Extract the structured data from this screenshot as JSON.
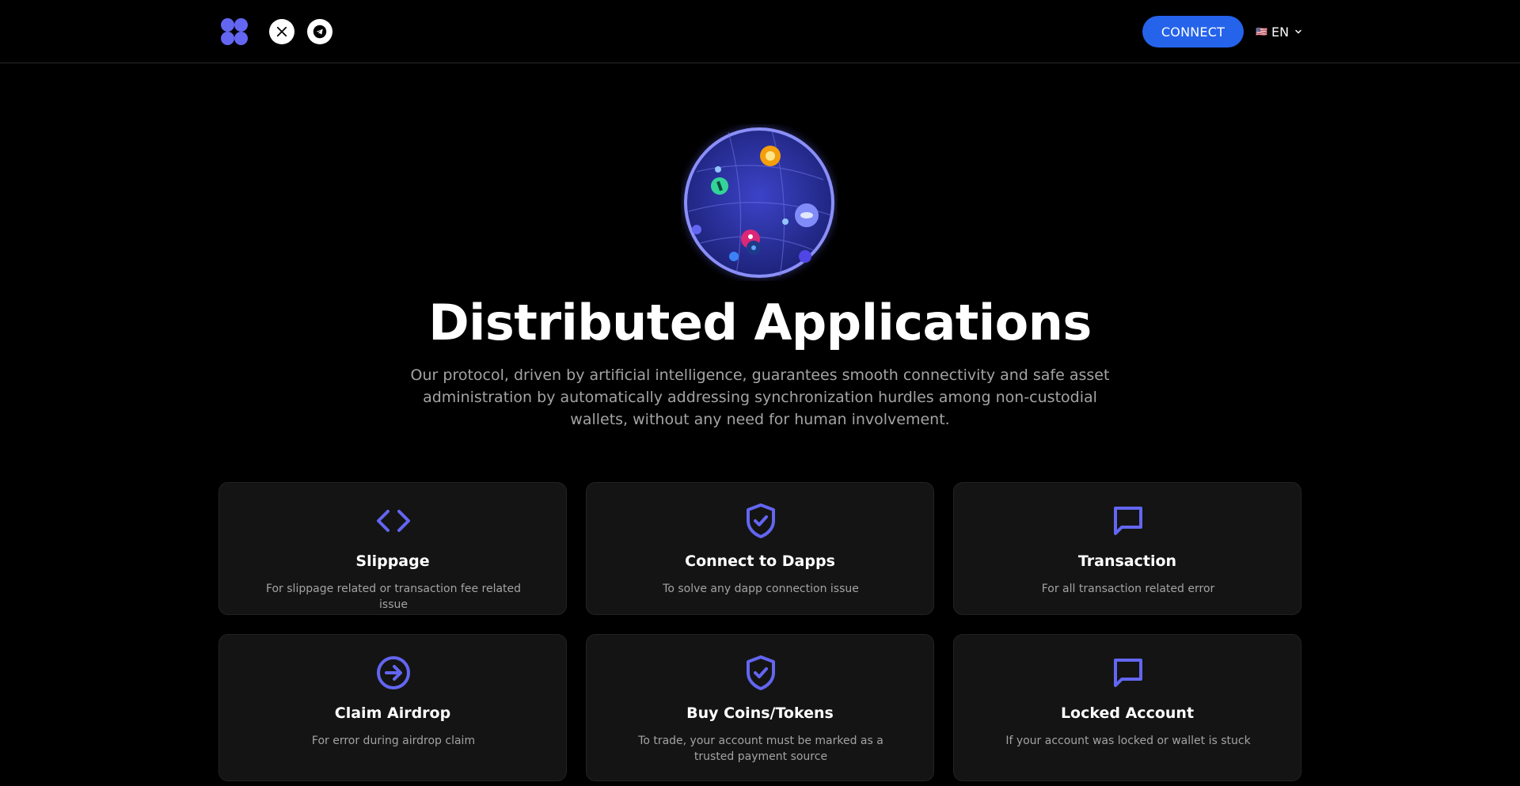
{
  "header": {
    "connect_label": "CONNECT",
    "language": {
      "flag": "🇺🇸",
      "code": "EN"
    },
    "social": [
      {
        "icon": "x-twitter-icon"
      },
      {
        "icon": "telegram-icon"
      }
    ]
  },
  "hero": {
    "title": "Distributed Applications",
    "subtitle": "Our protocol, driven by artificial intelligence, guarantees smooth connectivity and safe asset administration by automatically addressing synchronization hurdles among non-custodial wallets, without any need for human involvement."
  },
  "cards": [
    {
      "icon": "code-icon",
      "title": "Slippage",
      "desc": "For slippage related or transaction fee related issue"
    },
    {
      "icon": "shield-check-icon",
      "title": "Connect to Dapps",
      "desc": "To solve any dapp connection issue"
    },
    {
      "icon": "message-square-icon",
      "title": "Transaction",
      "desc": "For all transaction related error"
    },
    {
      "icon": "arrow-right-circle-icon",
      "title": "Claim Airdrop",
      "desc": "For error during airdrop claim"
    },
    {
      "icon": "shield-check-icon",
      "title": "Buy Coins/Tokens",
      "desc": "To trade, your account must be marked as a trusted payment source"
    },
    {
      "icon": "message-square-icon",
      "title": "Locked Account",
      "desc": "If your account was locked or wallet is stuck"
    }
  ],
  "colors": {
    "accent": "#6366f1",
    "connect_button": "#2563eb",
    "card_bg": "#141414",
    "background": "#000000"
  }
}
